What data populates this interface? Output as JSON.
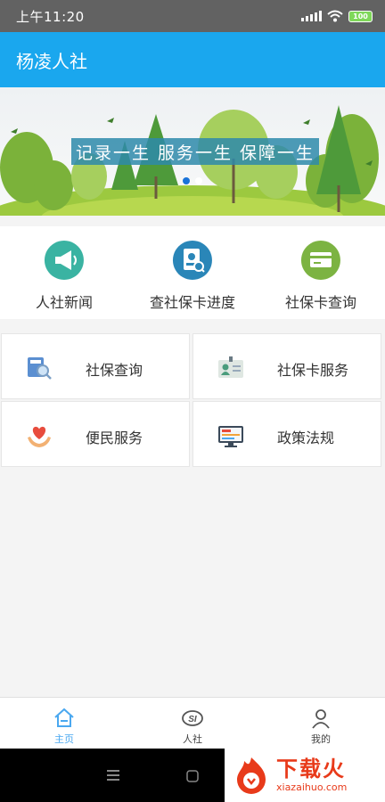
{
  "status_bar": {
    "time": "上午11:20",
    "battery": "100"
  },
  "header": {
    "title": "杨凌人社"
  },
  "banner": {
    "slogan": "记录一生 服务一生 保障一生"
  },
  "shortcuts": [
    {
      "label": "人社新闻",
      "icon": "megaphone-icon"
    },
    {
      "label": "查社保卡进度",
      "icon": "card-progress-icon"
    },
    {
      "label": "社保卡查询",
      "icon": "card-query-icon"
    }
  ],
  "services": [
    {
      "label": "社保查询",
      "icon": "book-search-icon"
    },
    {
      "label": "社保卡服务",
      "icon": "id-card-icon"
    },
    {
      "label": "便民服务",
      "icon": "heart-hands-icon"
    },
    {
      "label": "政策法规",
      "icon": "monitor-icon"
    }
  ],
  "tabs": [
    {
      "label": "主页",
      "icon": "home-icon",
      "active": true
    },
    {
      "label": "人社",
      "icon": "si-logo-icon",
      "active": false
    },
    {
      "label": "我的",
      "icon": "user-icon",
      "active": false
    }
  ],
  "watermark": {
    "title": "下载火",
    "url": "xiazaihuo.com"
  },
  "colors": {
    "primary": "#1aa7ee",
    "active_tab": "#4aa8f0",
    "status_bar": "#626262"
  }
}
